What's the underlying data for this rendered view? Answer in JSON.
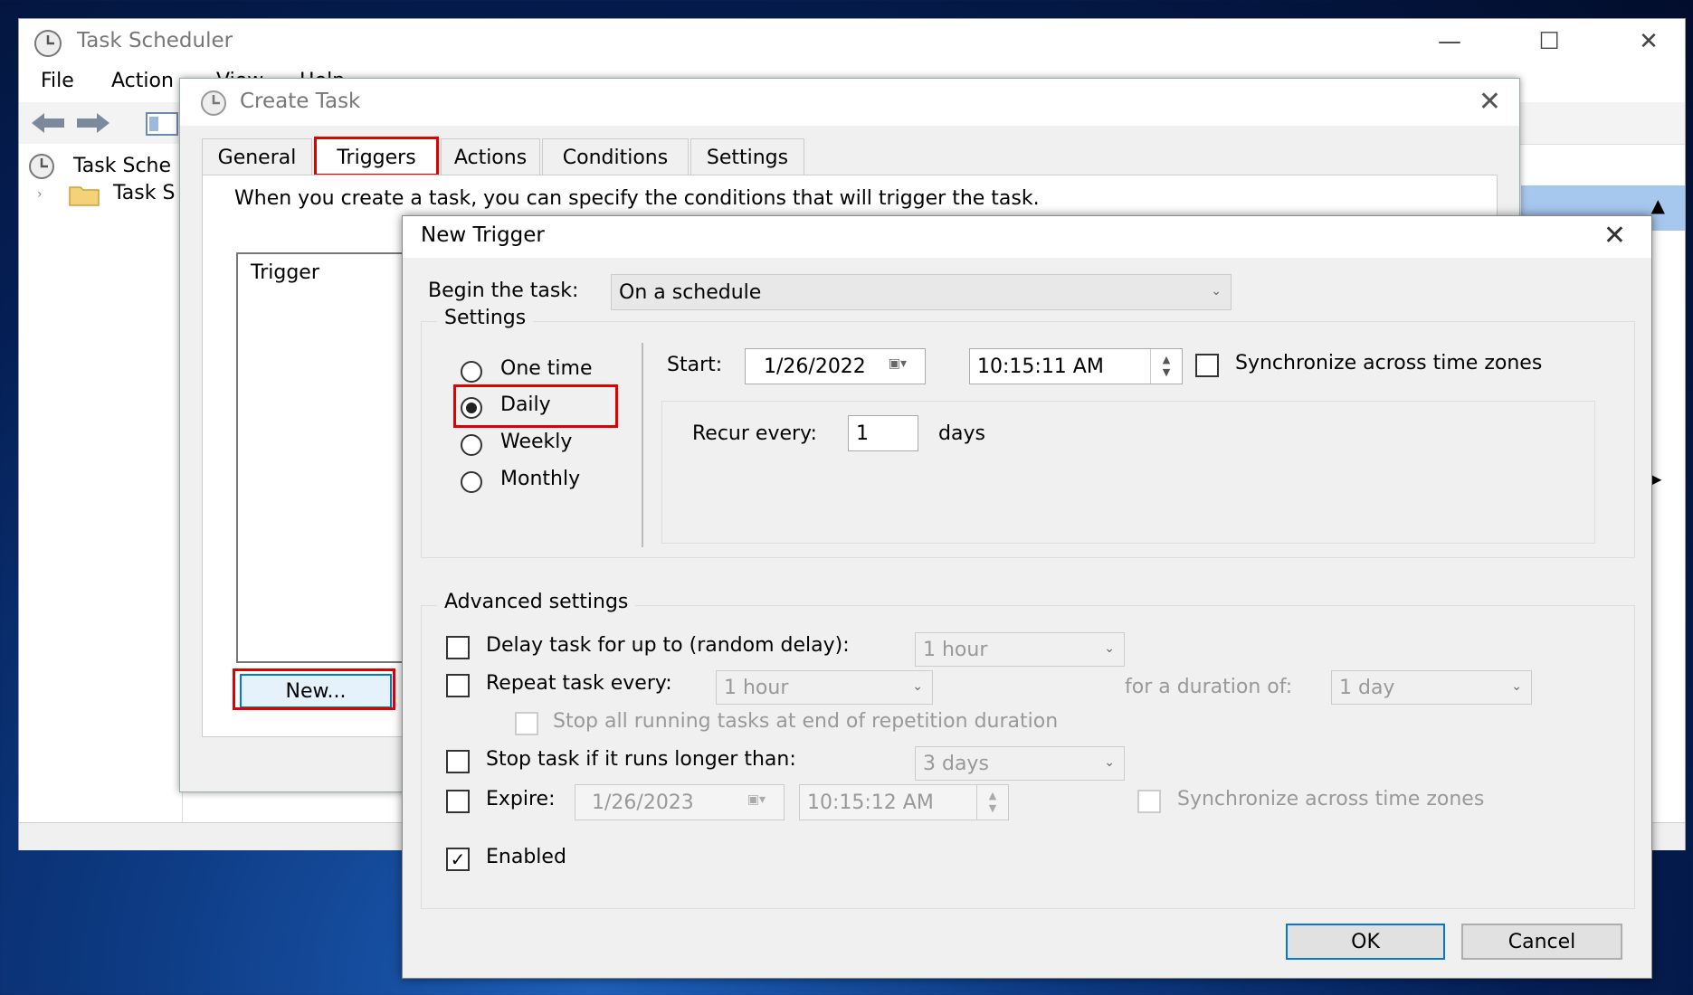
{
  "task_scheduler": {
    "title": "Task Scheduler",
    "menu": [
      "File",
      "Action",
      "View",
      "Help"
    ],
    "tree": [
      "Task Sche",
      "Task S"
    ]
  },
  "create_task": {
    "title": "Create Task",
    "tabs": [
      "General",
      "Triggers",
      "Actions",
      "Conditions",
      "Settings"
    ],
    "selected_tab": "Triggers",
    "description": "When you create a task, you can specify the conditions that will trigger the task.",
    "trigger_list_header": "Trigger",
    "new_button": "New..."
  },
  "new_trigger": {
    "title": "New Trigger",
    "begin_label": "Begin the task:",
    "begin_value": "On a schedule",
    "settings_label": "Settings",
    "schedule_options": [
      "One time",
      "Daily",
      "Weekly",
      "Monthly"
    ],
    "selected_schedule": "Daily",
    "start_label": "Start:",
    "start_date": "1/26/2022",
    "start_time": "10:15:11 AM",
    "sync_label": "Synchronize across time zones",
    "recur_label": "Recur every:",
    "recur_value": "1",
    "recur_unit": "days",
    "advanced_label": "Advanced settings",
    "delay_label": "Delay task for up to (random delay):",
    "delay_value": "1 hour",
    "repeat_label": "Repeat task every:",
    "repeat_value": "1 hour",
    "duration_label": "for a duration of:",
    "duration_value": "1 day",
    "stop_running_label": "Stop all running tasks at end of repetition duration",
    "stop_longer_label": "Stop task if it runs longer than:",
    "stop_longer_value": "3 days",
    "expire_label": "Expire:",
    "expire_date": "1/26/2023",
    "expire_time": "10:15:12 AM",
    "expire_sync_label": "Synchronize across time zones",
    "enabled_label": "Enabled",
    "enabled_checked": true,
    "ok_label": "OK",
    "cancel_label": "Cancel"
  },
  "colors": {
    "highlight": "#e00000",
    "accent": "#0078d7"
  }
}
